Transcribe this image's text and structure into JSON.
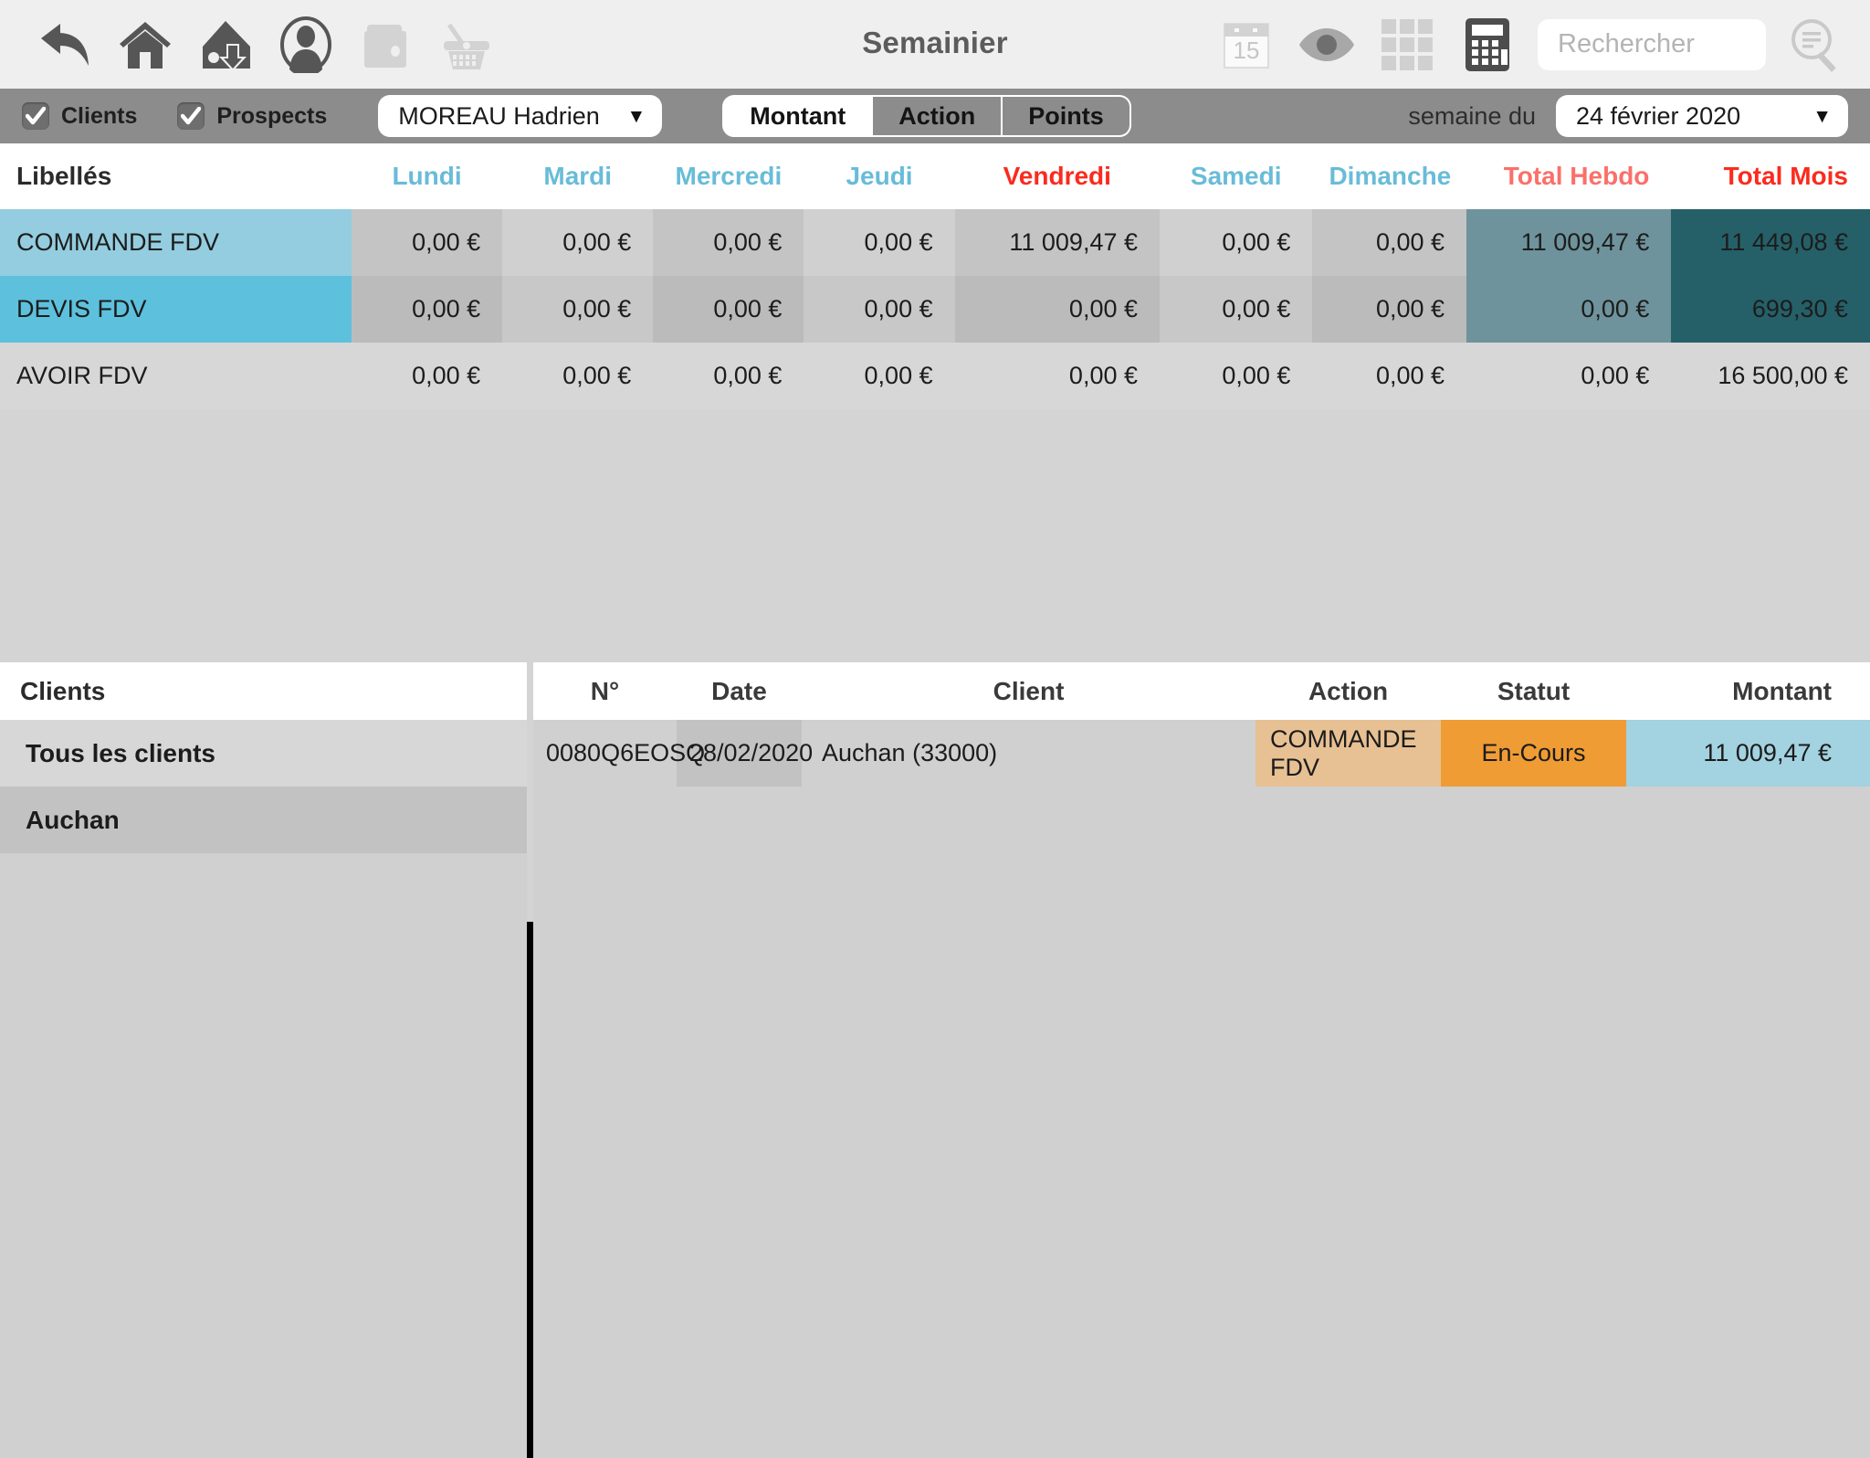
{
  "toolbar": {
    "title": "Semainier",
    "left_icons": [
      {
        "name": "back-arrow-icon",
        "label": "Retour"
      },
      {
        "name": "home-icon",
        "label": "Accueil"
      },
      {
        "name": "home-download-icon",
        "label": "Synchroniser"
      },
      {
        "name": "contact-icon",
        "label": "Contacts"
      },
      {
        "name": "briefcase-icon",
        "label": "Dossiers"
      },
      {
        "name": "basket-icon",
        "label": "Panier"
      }
    ],
    "right_icons": [
      {
        "name": "calendar-icon",
        "label": "Calendrier",
        "day": "15"
      },
      {
        "name": "eye-icon",
        "label": "Visualiser"
      },
      {
        "name": "grid-icon",
        "label": "Grille"
      },
      {
        "name": "calculator-icon",
        "label": "Calculatrice"
      },
      {
        "name": "search-filter-icon",
        "label": "Recherche avancée"
      }
    ],
    "search": {
      "value": "",
      "placeholder": "Rechercher"
    }
  },
  "filterbar": {
    "clients_label": "Clients",
    "clients_checked": true,
    "prospects_label": "Prospects",
    "prospects_checked": true,
    "person_select": "MOREAU Hadrien",
    "segments": [
      {
        "label": "Montant",
        "active": true
      },
      {
        "label": "Action",
        "active": false
      },
      {
        "label": "Points",
        "active": false
      }
    ],
    "week_label": "semaine du",
    "week_select": "24 février 2020",
    "arrow_glyph": "▼"
  },
  "grid": {
    "headers": [
      "Libellés",
      "Lundi",
      "Mardi",
      "Mercredi",
      "Jeudi",
      "Vendredi",
      "Samedi",
      "Dimanche",
      "Total Hebdo",
      "Total Mois"
    ],
    "rows": [
      {
        "label": "COMMANDE FDV",
        "values": [
          "0,00 €",
          "0,00 €",
          "0,00 €",
          "0,00 €",
          "11 009,47 €",
          "0,00 €",
          "0,00 €"
        ],
        "total_hebdo": "11 009,47 €",
        "total_mois": "11 449,08 €"
      },
      {
        "label": "DEVIS FDV",
        "values": [
          "0,00 €",
          "0,00 €",
          "0,00 €",
          "0,00 €",
          "0,00 €",
          "0,00 €",
          "0,00 €"
        ],
        "total_hebdo": "0,00 €",
        "total_mois": "699,30 €"
      },
      {
        "label": "AVOIR FDV",
        "values": [
          "0,00 €",
          "0,00 €",
          "0,00 €",
          "0,00 €",
          "0,00 €",
          "0,00 €",
          "0,00 €"
        ],
        "total_hebdo": "0,00 €",
        "total_mois": "16 500,00 €"
      }
    ]
  },
  "clients_panel": {
    "header": "Clients",
    "items": [
      {
        "label": "Tous les clients",
        "selected": false
      },
      {
        "label": "Auchan",
        "selected": true
      }
    ]
  },
  "docs_panel": {
    "headers": [
      "N°",
      "Date",
      "Client",
      "Action",
      "Statut",
      "Montant"
    ],
    "rows": [
      {
        "num": "0080Q6EOSQ",
        "date": "28/02/2020",
        "client": "Auchan (33000)",
        "action": "COMMANDE FDV",
        "statut": "En-Cours",
        "montant": "11 009,47 €"
      }
    ]
  },
  "colors": {
    "toolbar_bg": "#efefef",
    "filterbar_bg": "#8c8c8c",
    "day_header": "#68bcd8",
    "friday_header": "#fa2b1e",
    "total_hebdo_header": "#fa706a",
    "total_mois_header": "#fa2b1e",
    "row_label_light": "#93cddf",
    "row_label_dark": "#5dc1dd",
    "total_hebdo_cell": "#6e939c",
    "total_mois_cell": "#256069",
    "action_cell": "#e7c193",
    "statut_cell": "#ef9c35",
    "montant_cell": "#a3d2e0"
  }
}
